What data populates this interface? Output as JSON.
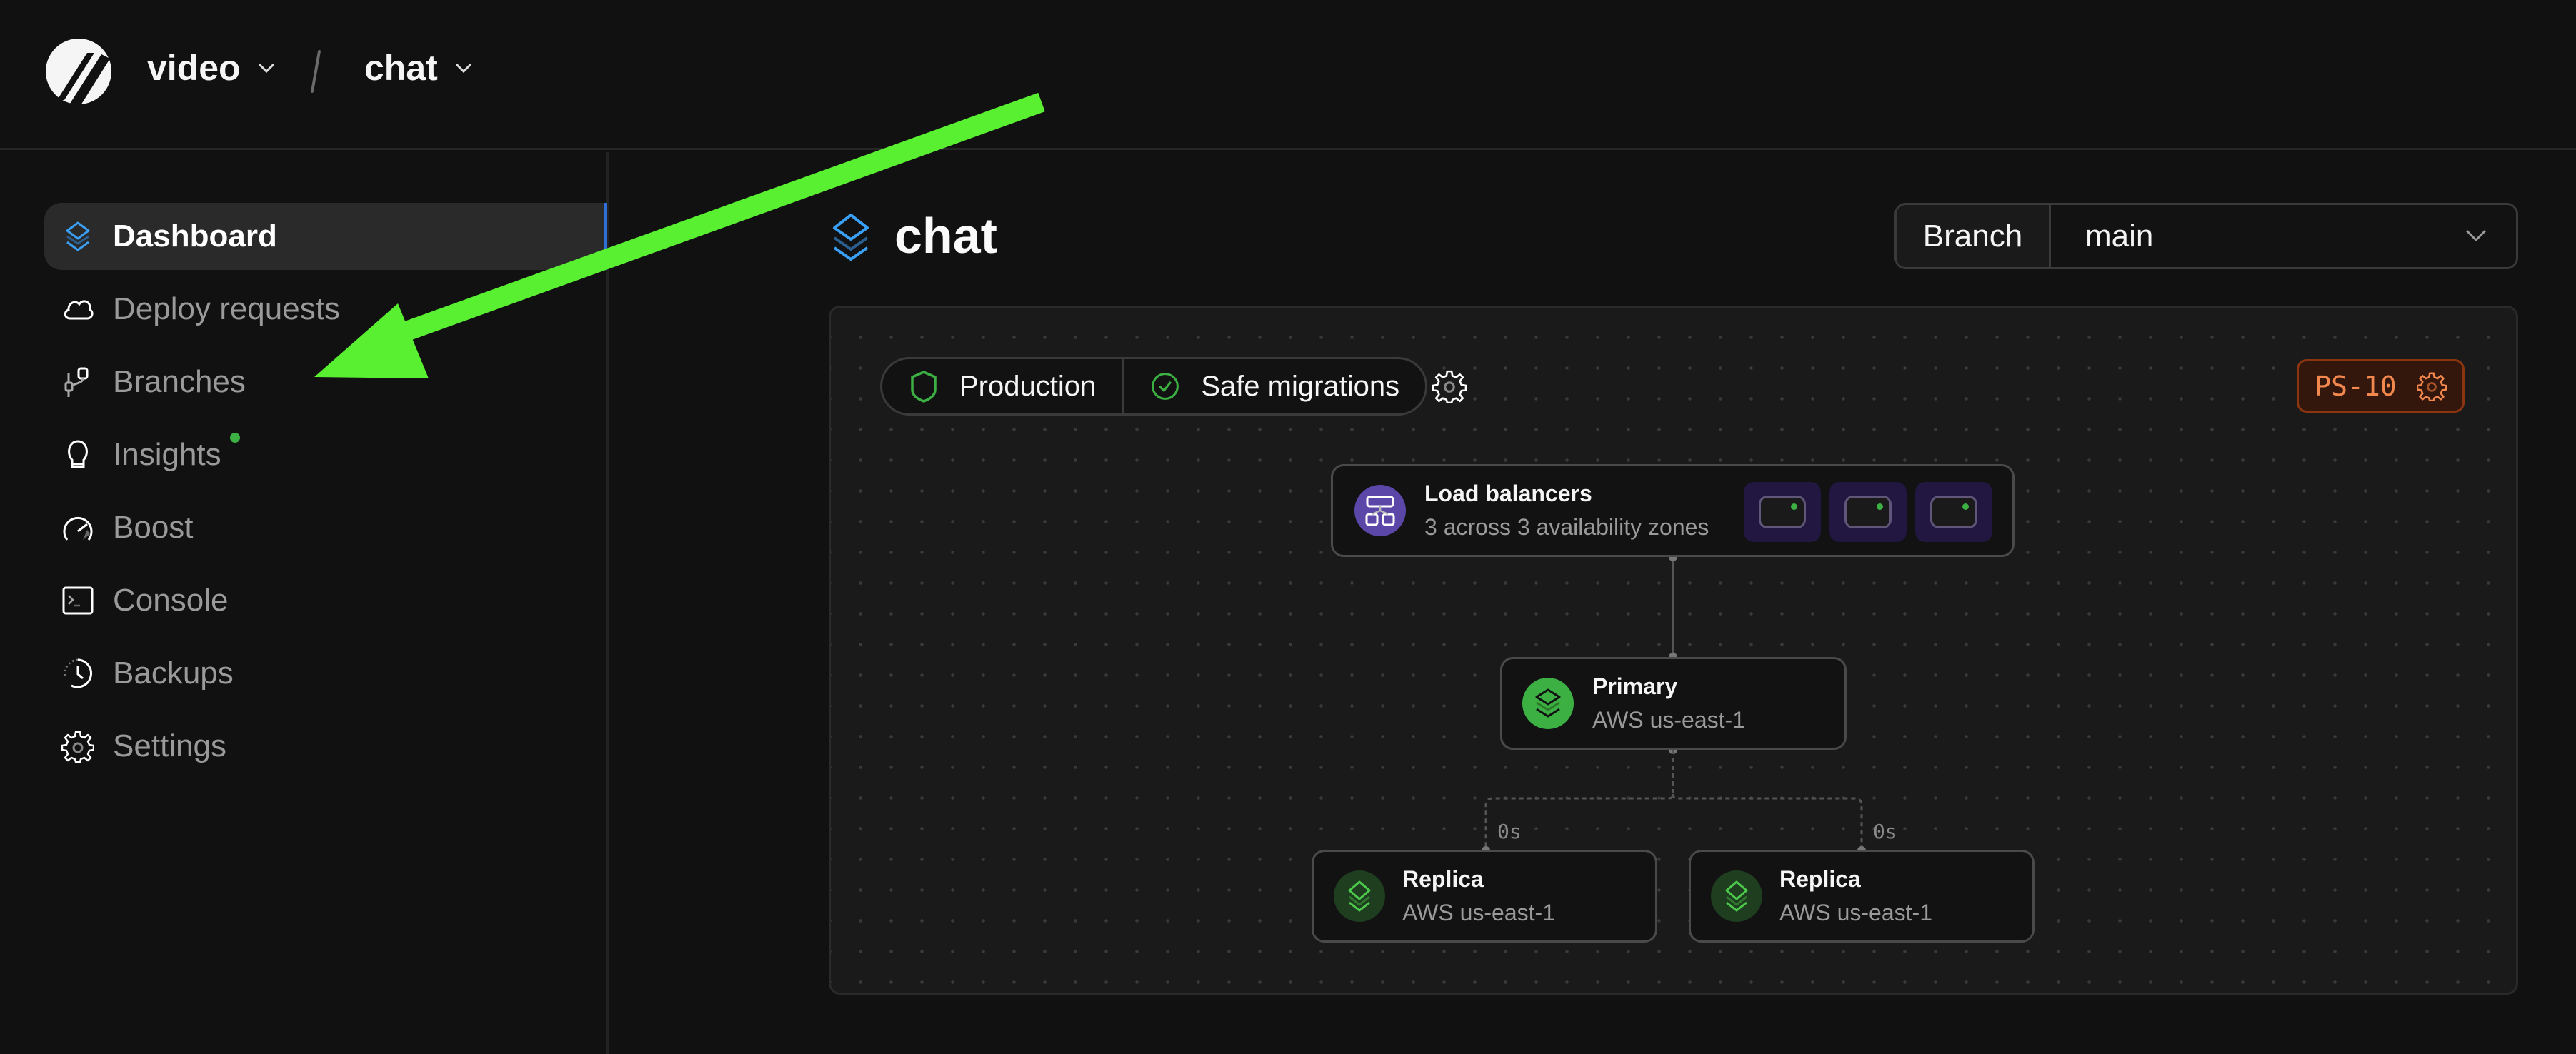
{
  "header": {
    "org": "video",
    "database": "chat"
  },
  "sidebar": {
    "items": [
      {
        "label": "Dashboard",
        "icon": "layers-icon",
        "active": true
      },
      {
        "label": "Deploy requests",
        "icon": "cloud-icon"
      },
      {
        "label": "Branches",
        "icon": "branch-icon"
      },
      {
        "label": "Insights",
        "icon": "lightbulb-icon",
        "badge": "new-dot"
      },
      {
        "label": "Boost",
        "icon": "speedometer-icon"
      },
      {
        "label": "Console",
        "icon": "terminal-icon"
      },
      {
        "label": "Backups",
        "icon": "clock-icon"
      },
      {
        "label": "Settings",
        "icon": "gear-icon"
      }
    ]
  },
  "main": {
    "title": "chat",
    "branch": {
      "label": "Branch",
      "value": "main"
    },
    "pills": [
      {
        "label": "Production",
        "icon": "shield-icon"
      },
      {
        "label": "Safe migrations",
        "icon": "check-circle-icon"
      }
    ],
    "cluster_size": "PS-10",
    "topology": {
      "load_balancers": {
        "title": "Load balancers",
        "subtitle": "3 across 3 availability zones",
        "count": 3
      },
      "primary": {
        "title": "Primary",
        "subtitle": "AWS us-east-1"
      },
      "replicas": [
        {
          "title": "Replica",
          "subtitle": "AWS us-east-1",
          "lag": "0s"
        },
        {
          "title": "Replica",
          "subtitle": "AWS us-east-1",
          "lag": "0s"
        }
      ]
    }
  },
  "colors": {
    "accent_blue": "#3aa0f5",
    "active_indicator": "#2f6fd8",
    "success_green": "#3cb043",
    "lb_purple": "#5b47a8",
    "badge_orange": "#f3884e",
    "annotation_arrow": "#5af032"
  }
}
